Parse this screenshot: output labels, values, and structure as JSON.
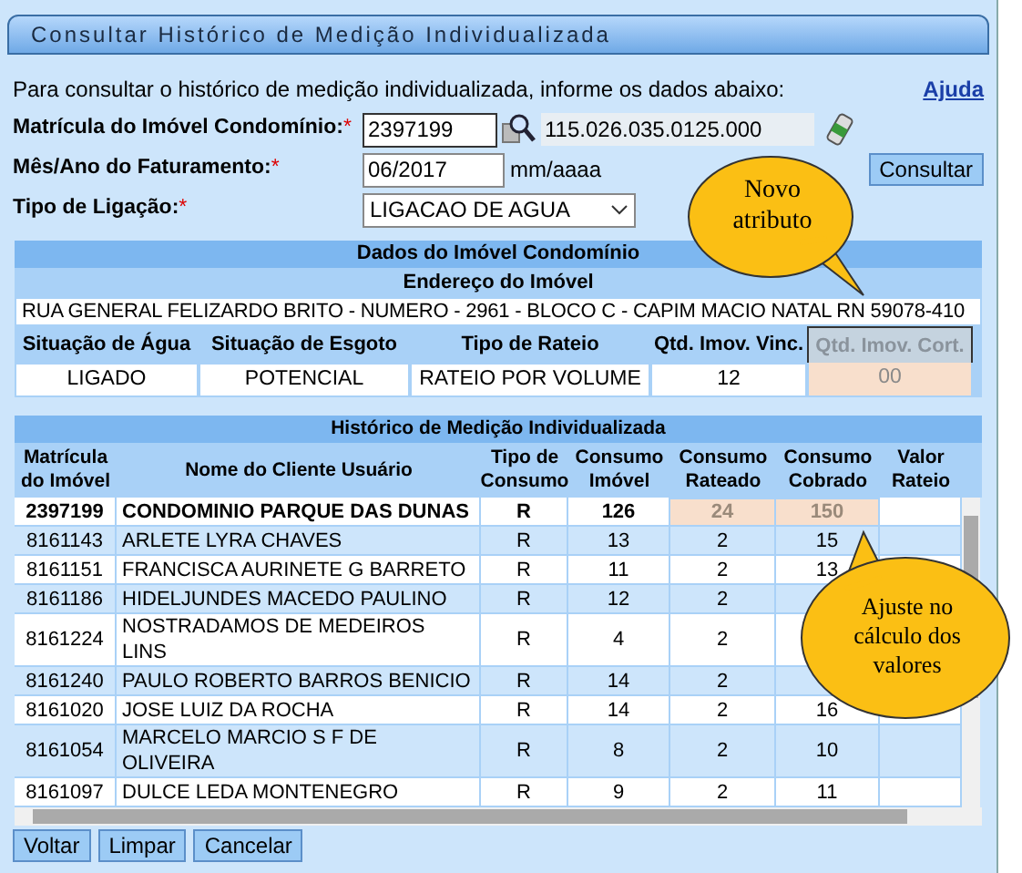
{
  "window": {
    "title": "Consultar Histórico de Medição Individualizada"
  },
  "intro": "Para consultar o histórico de medição individualizada, informe os dados abaixo:",
  "help_link": "Ajuda",
  "form": {
    "fields": [
      {
        "kind": "matricula",
        "label": "Matrícula do Imóvel Condomínio:",
        "required_mark": "*",
        "value": "2397199",
        "info": "115.026.035.0125.000"
      },
      {
        "kind": "date",
        "label": "Mês/Ano do Faturamento:",
        "required_mark": "*",
        "value": "06/2017",
        "hint": "mm/aaaa"
      },
      {
        "kind": "select",
        "label": "Tipo de Ligação:",
        "required_mark": "*",
        "value": "LIGACAO DE AGUA"
      }
    ],
    "submit": "Consultar"
  },
  "property": {
    "title": "Dados do Imóvel Condomínio",
    "address_heading": "Endereço do Imóvel",
    "address": "RUA GENERAL FELIZARDO BRITO - NUMERO - 2961 - BLOCO C - CAPIM MACIO NATAL RN 59078-410",
    "columns": [
      {
        "label": "Situação de Água",
        "highlighted": false
      },
      {
        "label": "Situação de Esgoto",
        "highlighted": false
      },
      {
        "label": "Tipo de Rateio",
        "highlighted": false
      },
      {
        "label": "Qtd. Imov. Vinc.",
        "highlighted": false
      },
      {
        "label": "Qtd. Imov. Cort.",
        "highlighted": true
      }
    ],
    "values": [
      "LIGADO",
      "POTENCIAL",
      "RATEIO POR VOLUME",
      "12",
      "00"
    ]
  },
  "history": {
    "title": "Histórico de Medição Individualizada",
    "columns": [
      "Matrícula do Imóvel",
      "Nome do Cliente Usuário",
      "Tipo de Consumo",
      "Consumo Imóvel",
      "Consumo Rateado",
      "Consumo Cobrado",
      "Valor Rateio"
    ],
    "rows": [
      {
        "bold": true,
        "cells": [
          "2397199",
          "CONDOMINIO PARQUE DAS DUNAS",
          "R",
          "126",
          {
            "text": "24",
            "highlighted": true
          },
          {
            "text": "150",
            "highlighted": true
          }
        ]
      },
      {
        "bold": false,
        "cells": [
          "8161143",
          "ARLETE LYRA CHAVES",
          "R",
          "13",
          "2",
          "15"
        ]
      },
      {
        "bold": false,
        "cells": [
          "8161151",
          "FRANCISCA AURINETE G BARRETO",
          "R",
          "11",
          "2",
          "13"
        ]
      },
      {
        "bold": false,
        "cells": [
          "8161186",
          "HIDELJUNDES MACEDO PAULINO",
          "R",
          "12",
          "2",
          null
        ]
      },
      {
        "bold": false,
        "cells": [
          "8161224",
          "NOSTRADAMOS DE MEDEIROS LINS",
          "R",
          "4",
          "2",
          null
        ]
      },
      {
        "bold": false,
        "cells": [
          "8161240",
          "PAULO ROBERTO BARROS BENICIO",
          "R",
          "14",
          "2",
          null
        ]
      },
      {
        "bold": false,
        "cells": [
          "8161020",
          "JOSE LUIZ DA ROCHA",
          "R",
          "14",
          "2",
          "16"
        ]
      },
      {
        "bold": false,
        "cells": [
          "8161054",
          "MARCELO MARCIO S F DE OLIVEIRA",
          "R",
          "8",
          "2",
          "10"
        ]
      },
      {
        "bold": false,
        "cells": [
          "8161097",
          "DULCE LEDA MONTENEGRO",
          "R",
          "9",
          "2",
          "11"
        ]
      }
    ]
  },
  "buttons": [
    "Voltar",
    "Limpar",
    "Cancelar"
  ],
  "callouts": [
    {
      "text": "Novo atributo"
    },
    {
      "text": "Ajuste no cálculo dos valores"
    }
  ]
}
